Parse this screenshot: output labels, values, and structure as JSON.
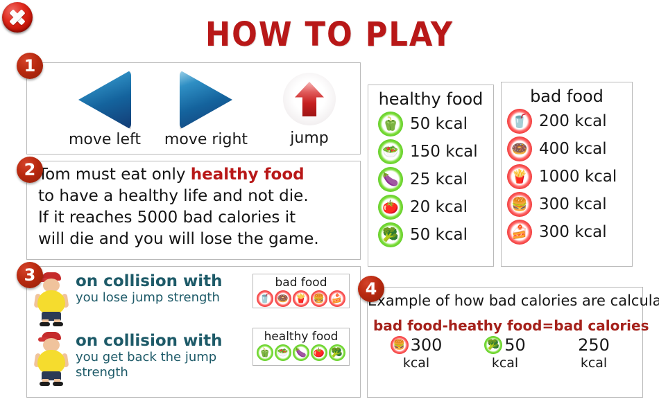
{
  "window": {
    "title": "HOW TO PLAY",
    "close_label": "×",
    "title_color": "#b81818",
    "badge_color": "#b8290f",
    "teal_color": "#1d5a68"
  },
  "sections": {
    "controls": {
      "badge": "1",
      "items": [
        {
          "icon": "arrow-left-icon",
          "label": "move left"
        },
        {
          "icon": "arrow-right-icon",
          "label": "move right"
        },
        {
          "icon": "arrow-up-icon",
          "label": "jump"
        }
      ]
    },
    "rules": {
      "badge": "2",
      "line1_a": "Tom must eat only ",
      "line1_b": "healthy food",
      "line2": "to have a healthy life and not die.",
      "line3": "If it reaches 5000 bad calories it",
      "line4": "will die and you will lose the game."
    },
    "collisions": {
      "badge": "3",
      "rows": [
        {
          "sprite": "tom-sprite",
          "heading": "on collision with",
          "sub": "you lose jump strength",
          "box_title": "bad food",
          "box_icons": [
            "soda-icon",
            "donut-icon",
            "fast-food-tray-icon",
            "burger-icon",
            "cake-icon"
          ]
        },
        {
          "sprite": "tom-sprite",
          "heading": "on collision with",
          "sub": "you get back the jump strength",
          "box_title": "healthy food",
          "box_icons": [
            "peppers-icon",
            "salad-icon",
            "eggplant-icon",
            "tomato-icon",
            "broccoli-icon"
          ]
        }
      ]
    },
    "example": {
      "badge": "4",
      "title": "Example of how bad calories are calculated",
      "formula": {
        "term1": "bad food",
        "op1": "-",
        "term2": "heathy food",
        "op2": "=",
        "term3": "bad calories"
      },
      "values": [
        {
          "icon": "burger-icon",
          "icon_type": "bad",
          "number": "300",
          "unit": "kcal"
        },
        {
          "icon": "broccoli-icon",
          "icon_type": "good",
          "number": "50",
          "unit": "kcal"
        },
        {
          "icon": "none",
          "icon_type": "none",
          "number": "250",
          "unit": "kcal"
        }
      ]
    }
  },
  "healthy_food": {
    "title": "healthy food",
    "items": [
      {
        "icon": "peppers-icon",
        "glyph": "🫑",
        "kcal": "50 kcal"
      },
      {
        "icon": "salad-icon",
        "glyph": "🥗",
        "kcal": "150 kcal"
      },
      {
        "icon": "eggplant-icon",
        "glyph": "🍆",
        "kcal": "25 kcal"
      },
      {
        "icon": "tomato-icon",
        "glyph": "🍅",
        "kcal": "20 kcal"
      },
      {
        "icon": "broccoli-icon",
        "glyph": "🥦",
        "kcal": "50 kcal"
      }
    ]
  },
  "bad_food": {
    "title": "bad food",
    "items": [
      {
        "icon": "soda-icon",
        "glyph": "🥤",
        "kcal": "200 kcal"
      },
      {
        "icon": "donut-icon",
        "glyph": "🍩",
        "kcal": "400 kcal"
      },
      {
        "icon": "fast-food-tray-icon",
        "glyph": "🍟",
        "kcal": "1000 kcal"
      },
      {
        "icon": "burger-icon",
        "glyph": "🍔",
        "kcal": "300 kcal"
      },
      {
        "icon": "cake-icon",
        "glyph": "🍰",
        "kcal": "300 kcal"
      }
    ]
  }
}
